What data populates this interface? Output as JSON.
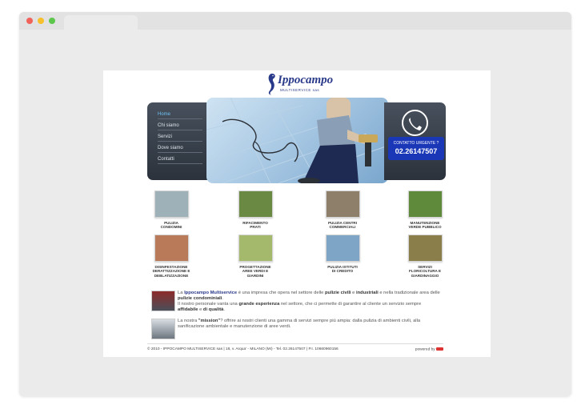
{
  "logo": {
    "title": "Ippocampo",
    "subtitle": "MULTISERVICE sas"
  },
  "nav": {
    "items": [
      "Home",
      "Chi siamo",
      "Servizi",
      "Dove siamo",
      "Contatti"
    ]
  },
  "contact": {
    "label": "CONTATTO URGENTE ?",
    "phone": "02.26147507"
  },
  "services": [
    {
      "l1": "PULIZIA",
      "l2": "CONDOMINI",
      "l3": "",
      "color": "#9fb1b8"
    },
    {
      "l1": "RIFACIMENTO",
      "l2": "PRATI",
      "l3": "",
      "color": "#6a8a44"
    },
    {
      "l1": "PULIZIA CENTRI",
      "l2": "COMMERCIALI",
      "l3": "",
      "color": "#8e7f6a"
    },
    {
      "l1": "MANUTENZIONE",
      "l2": "VERDE PUBBLICO",
      "l3": "",
      "color": "#5f8a3c"
    },
    {
      "l1": "DISINFESTAZIONE",
      "l2": "DERATTIZZAZIONE E",
      "l3": "DEBLATIZZAZIONE",
      "color": "#b87a58"
    },
    {
      "l1": "PROGETTAZIONE",
      "l2": "AREE VERDI E",
      "l3": "GIARDINI",
      "color": "#a5b96c"
    },
    {
      "l1": "PULIZIA ISTITUTI",
      "l2": "DI CREDITO",
      "l3": "",
      "color": "#7ea4c6"
    },
    {
      "l1": "SERVIZI",
      "l2": "FLORICOLTURA E",
      "l3": "GIARDINAGGIO",
      "color": "#8a7e4a"
    }
  ],
  "intro": {
    "p1_before": "La ",
    "p1_company": "Ippocampo Multiservice",
    "p1_mid": " è una impresa che opera nel settore delle ",
    "p1_b1": "pulizie civili",
    "p1_and": " e ",
    "p1_b2": "industriali",
    "p1_after": " e nella tradizionale area delle ",
    "p1_b3": "pulizie condominiali",
    "p1_end": ".",
    "p2_before": "Il nostro personale vanta una ",
    "p2_b1": "grande esperienza",
    "p2_mid": " nel settore, che ci permette di garantire al cliente un servizio sempre ",
    "p2_b2": "affidabile",
    "p2_and": " e ",
    "p2_b3": "di qualità",
    "p2_end": ".",
    "p3_before": "La nostra ",
    "p3_b1": "\"mission\"",
    "p3_after": "? offrire ai nostri clienti una gamma di servizi sempre più ampia: dalla pulizia di ambienti civili, alla sanificazione ambientale e manutenzione di aree verdi."
  },
  "footer": {
    "left": "© 2010 - IPPOCAMPO MULTISERVICE sas | 18, v. Arqua' - MILANO (MI) - Tel. 02.26147507 | P.I. 10660960156",
    "right": "powered by"
  }
}
